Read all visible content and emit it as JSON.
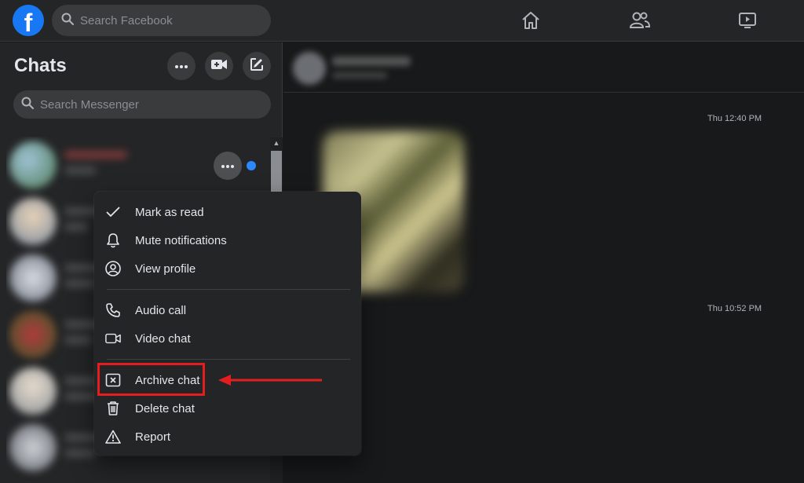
{
  "topbar": {
    "logo_letter": "f",
    "search_placeholder": "Search Facebook",
    "nav": [
      "home-icon",
      "friends-icon",
      "watch-icon"
    ]
  },
  "sidebar": {
    "title": "Chats",
    "buttons": [
      "more-options-icon",
      "new-room-icon",
      "new-message-icon"
    ],
    "search_placeholder": "Search Messenger"
  },
  "conversation": {
    "timestamps": [
      "Thu 12:40 PM",
      "Thu 10:52 PM"
    ]
  },
  "context_menu": {
    "groups": [
      [
        {
          "label": "Mark as read",
          "icon": "check-icon"
        },
        {
          "label": "Mute notifications",
          "icon": "bell-icon"
        },
        {
          "label": "View profile",
          "icon": "profile-icon"
        }
      ],
      [
        {
          "label": "Audio call",
          "icon": "phone-icon"
        },
        {
          "label": "Video chat",
          "icon": "video-icon"
        }
      ],
      [
        {
          "label": "Archive chat",
          "icon": "archive-icon"
        },
        {
          "label": "Delete chat",
          "icon": "trash-icon"
        },
        {
          "label": "Report",
          "icon": "warning-icon"
        }
      ]
    ]
  },
  "annotation": {
    "highlight_color": "#e41e1e",
    "highlighted_item": "Archive chat"
  },
  "colors": {
    "accent": "#1877f2",
    "unread": "#2d88ff",
    "background": "#18191a",
    "surface": "#242526"
  }
}
